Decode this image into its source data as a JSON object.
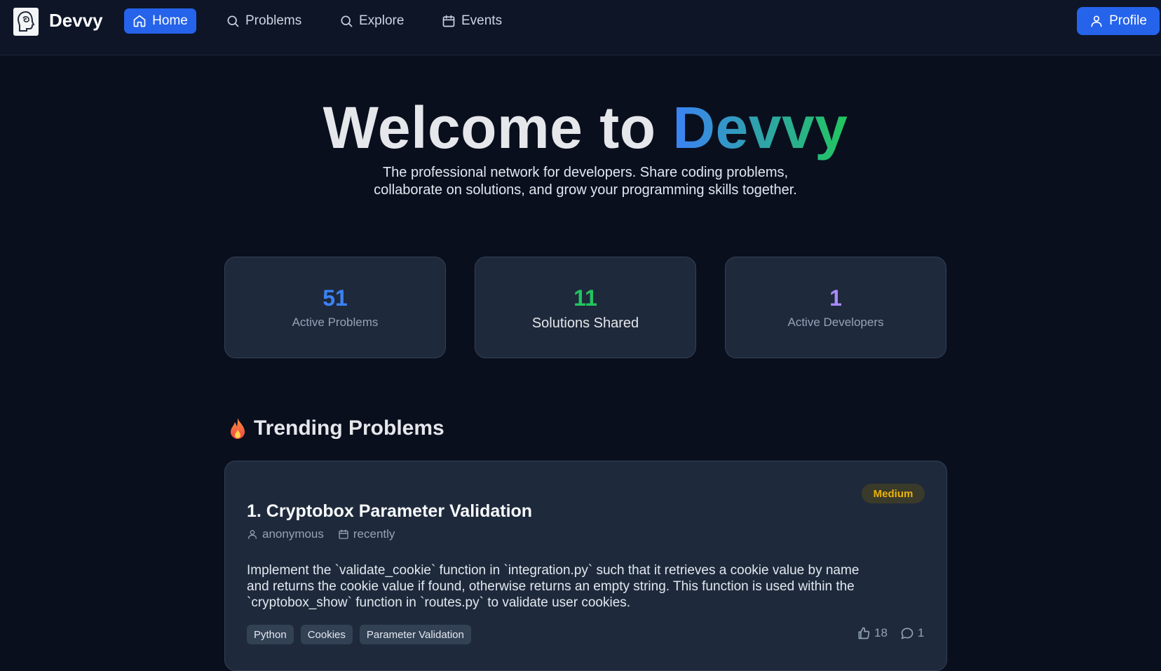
{
  "nav": {
    "brand": "Devvy",
    "items": [
      {
        "label": "Home",
        "icon": "home-icon",
        "active": true
      },
      {
        "label": "Problems",
        "icon": "search-icon",
        "active": false
      },
      {
        "label": "Explore",
        "icon": "search-icon",
        "active": false
      },
      {
        "label": "Events",
        "icon": "calendar-icon",
        "active": false
      }
    ],
    "profile_label": "Profile"
  },
  "hero": {
    "title_prefix": "Welcome to ",
    "title_accent": "Devvy",
    "subtitle_line1": "The professional network for developers. Share coding problems,",
    "subtitle_line2": "collaborate on solutions, and grow your programming skills together."
  },
  "stats": [
    {
      "value": "51",
      "label": "Active Problems",
      "color": "#3b82f6"
    },
    {
      "value": "11",
      "label": "Solutions Shared",
      "color": "#22c55e"
    },
    {
      "value": "1",
      "label": "Active Developers",
      "color": "#a78bfa"
    }
  ],
  "trending": {
    "title": "Trending Problems",
    "problems": [
      {
        "title": "1. Cryptobox Parameter Validation",
        "difficulty": "Medium",
        "author": "anonymous",
        "date": "recently",
        "description_line1": "Implement the `validate_cookie` function in `integration.py` such that it retrieves a cookie value by name",
        "description_line2": "and returns the cookie value if found, otherwise returns an empty string. This function is used within the",
        "description_line3": "`cryptobox_show` function in `routes.py` to validate user cookies.",
        "tags": [
          "Python",
          "Cookies",
          "Parameter Validation"
        ],
        "likes": "18",
        "comments": "1"
      }
    ]
  },
  "colors": {
    "background": "#0a0f1e",
    "navbar": "#0e1527",
    "primary": "#2563eb",
    "card": "#1e293b",
    "medium_badge": "#eab308"
  }
}
